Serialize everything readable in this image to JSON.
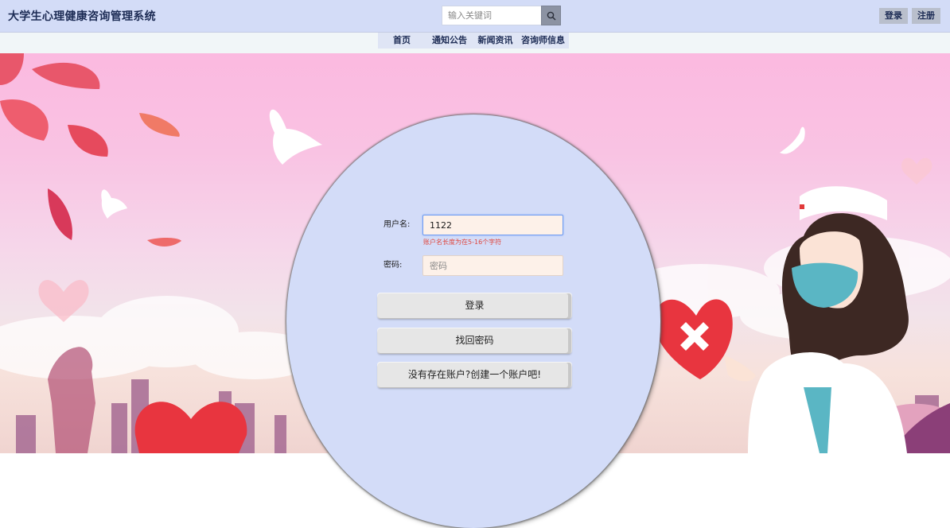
{
  "header": {
    "title": "大学生心理健康咨询管理系统",
    "search_placeholder": "输入关键词",
    "login_label": "登录",
    "register_label": "注册"
  },
  "nav": {
    "items": [
      "首页",
      "通知公告",
      "新闻资讯",
      "咨询师信息"
    ]
  },
  "login_form": {
    "username_label": "用户名:",
    "username_value": "1122",
    "username_error": "账户名长度为在5-16个字符",
    "password_label": "密码:",
    "password_placeholder": "密码",
    "login_button": "登录",
    "recover_button": "找回密码",
    "register_button": "没有存在账户?创建一个账户吧!"
  },
  "colors": {
    "header_bg": "#d3dcf7",
    "circle_bg": "#d3dcf8",
    "error": "#e0463d"
  }
}
